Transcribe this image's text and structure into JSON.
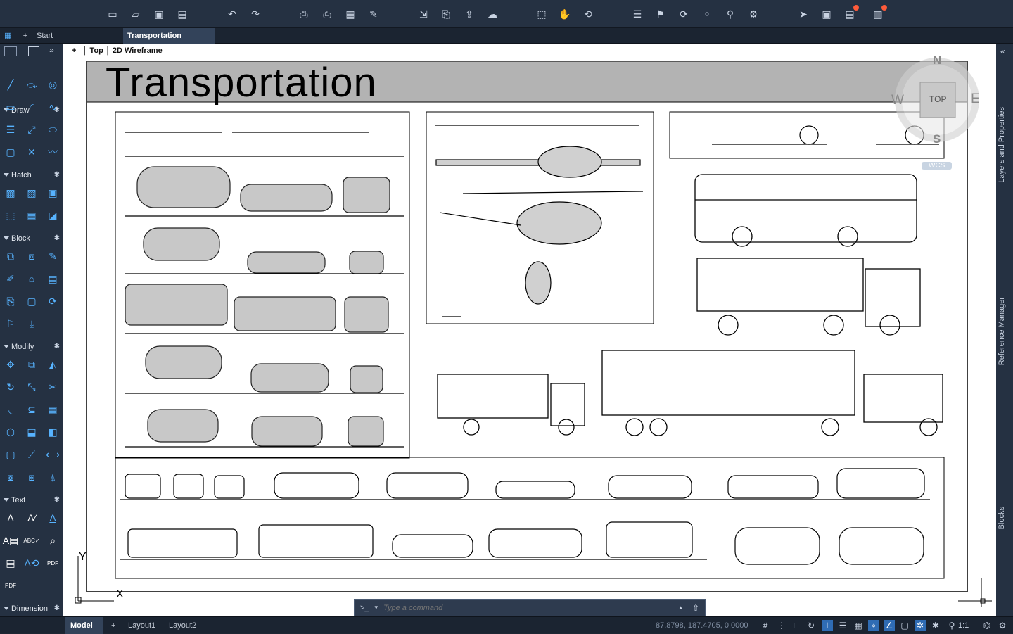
{
  "toolbar": {
    "icons": [
      "new-file-icon",
      "open-file-icon",
      "save-icon",
      "save-as-icon",
      "undo-icon",
      "redo-icon",
      "print-icon",
      "batch-print-icon",
      "publish-icon",
      "export-icon",
      "import-icon",
      "attach-icon",
      "share-icon",
      "cloud-icon",
      "zoom-window-icon",
      "pan-icon",
      "orbit-icon",
      "layer-props-icon",
      "match-props-icon",
      "sync-icon",
      "connect-icon",
      "xref-icon",
      "settings-icon",
      "send-icon",
      "view-icon",
      "app-store-icon",
      "notifications-icon"
    ]
  },
  "tabs": {
    "start": "Start",
    "active": "Transportation"
  },
  "viewport": {
    "plus": "+",
    "view": "Top",
    "style": "2D Wireframe"
  },
  "drawing": {
    "title": "Transportation"
  },
  "viewcube": {
    "n": "N",
    "s": "S",
    "e": "E",
    "w": "W",
    "top": "TOP",
    "wcs": "WCS"
  },
  "panels": {
    "draw": "Draw",
    "hatch": "Hatch",
    "block": "Block",
    "modify": "Modify",
    "text": "Text",
    "dimension": "Dimension"
  },
  "right_rail": {
    "layers": "Layers and Properties",
    "reference": "Reference Manager",
    "blocks": "Blocks"
  },
  "command": {
    "prompt": ">_",
    "placeholder": "Type a command"
  },
  "status": {
    "model": "Model",
    "layout1": "Layout1",
    "layout2": "Layout2",
    "coords": "87.8798, 187.4705, 0.0000",
    "scale": "1:1"
  },
  "ucs": {
    "x": "X",
    "y": "Y"
  }
}
